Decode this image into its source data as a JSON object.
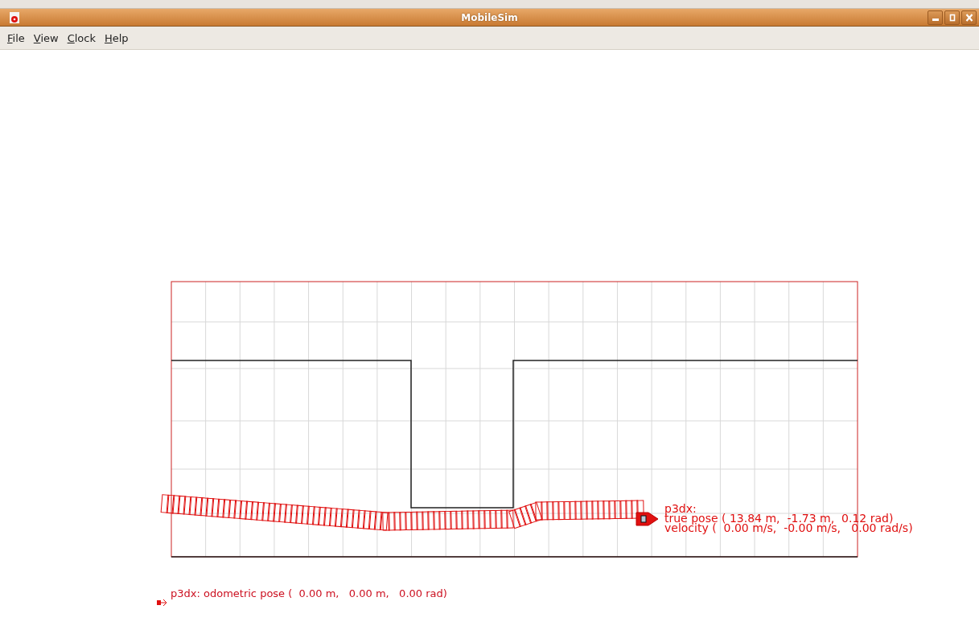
{
  "window": {
    "title": "MobileSim"
  },
  "menu": [
    {
      "label": "File"
    },
    {
      "label": "View"
    },
    {
      "label": "Clock"
    },
    {
      "label": "Help"
    }
  ],
  "robot": {
    "name": "p3dx:",
    "true_pose": "true pose ( 13.84 m,  -1.73 m,  0.12 rad)",
    "velocity": "velocity (  0.00 m/s,  -0.00 m/s,   0.00 rad/s)"
  },
  "odometry": "p3dx: odometric pose (  0.00 m,   0.00 m,   0.00 rad)"
}
